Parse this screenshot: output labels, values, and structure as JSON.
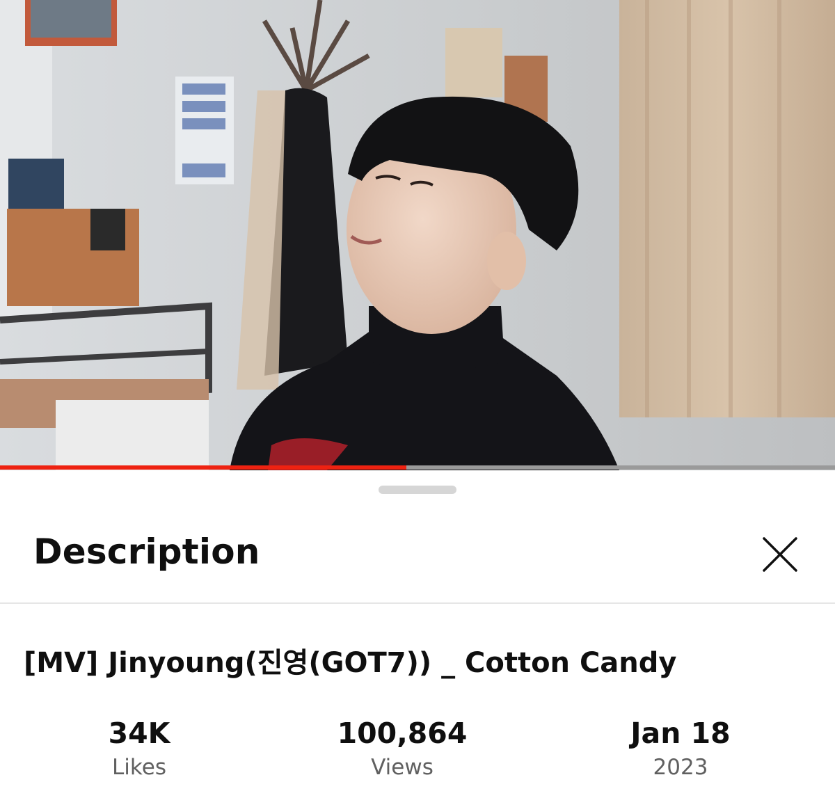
{
  "video": {
    "progress_fraction": 0.487
  },
  "sheet": {
    "title": "Description",
    "close_icon": "close-icon"
  },
  "video_info": {
    "title": "[MV] Jinyoung(진영(GOT7)) _ Cotton Candy",
    "stats": [
      {
        "value": "34K",
        "label": "Likes"
      },
      {
        "value": "100,864",
        "label": "Views"
      },
      {
        "value": "Jan 18",
        "label": "2023"
      }
    ]
  },
  "colors": {
    "progress": "#ee2211",
    "text": "#0f0f0f",
    "secondary_text": "#606060"
  }
}
